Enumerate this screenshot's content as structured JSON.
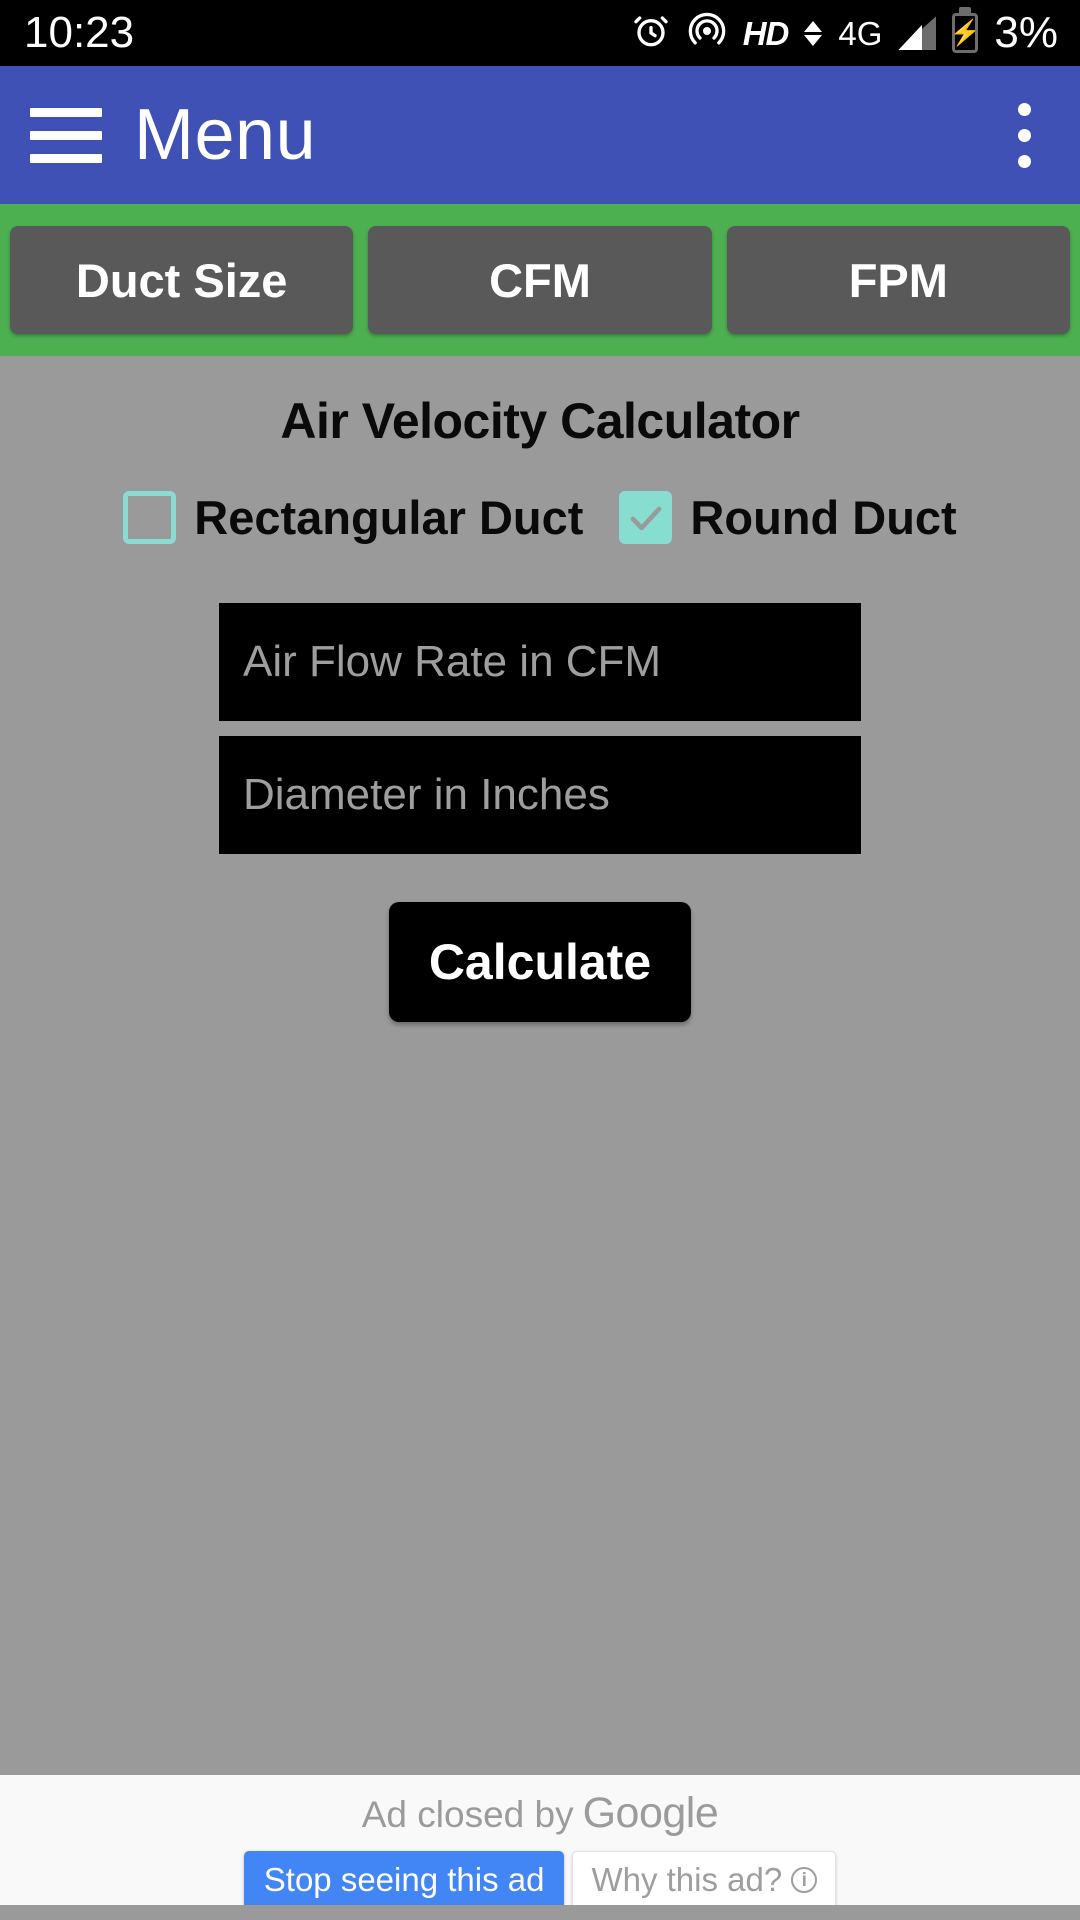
{
  "status_bar": {
    "time": "10:23",
    "battery_percent": "3%",
    "network_hd": "HD",
    "network_type": "4G",
    "icons": [
      "alarm-clock-icon",
      "hotspot-icon",
      "hd-icon",
      "data-transfer-icon",
      "signal-icon",
      "battery-charging-icon"
    ]
  },
  "app_bar": {
    "title": "Menu",
    "menu_icon": "hamburger-menu-icon",
    "overflow_icon": "kebab-menu-icon",
    "background_color": "#3f51b5"
  },
  "tabs": {
    "background_color": "#4caf50",
    "items": [
      {
        "label": "Duct Size"
      },
      {
        "label": "CFM"
      },
      {
        "label": "FPM"
      }
    ]
  },
  "main": {
    "title": "Air Velocity Calculator",
    "background_color": "#9a9a9a",
    "checkboxes": [
      {
        "label": "Rectangular Duct",
        "checked": false
      },
      {
        "label": "Round Duct",
        "checked": true
      }
    ],
    "checkbox_accent_color": "#86ddd0",
    "fields": [
      {
        "placeholder": "Air Flow Rate in CFM",
        "value": ""
      },
      {
        "placeholder": "Diameter in Inches",
        "value": ""
      }
    ],
    "calculate_label": "Calculate"
  },
  "ad": {
    "closed_text": "Ad closed by",
    "brand": "Google",
    "stop_label": "Stop seeing this ad",
    "why_label": "Why this ad?",
    "info_glyph": "i",
    "stop_color": "#4285f4"
  }
}
